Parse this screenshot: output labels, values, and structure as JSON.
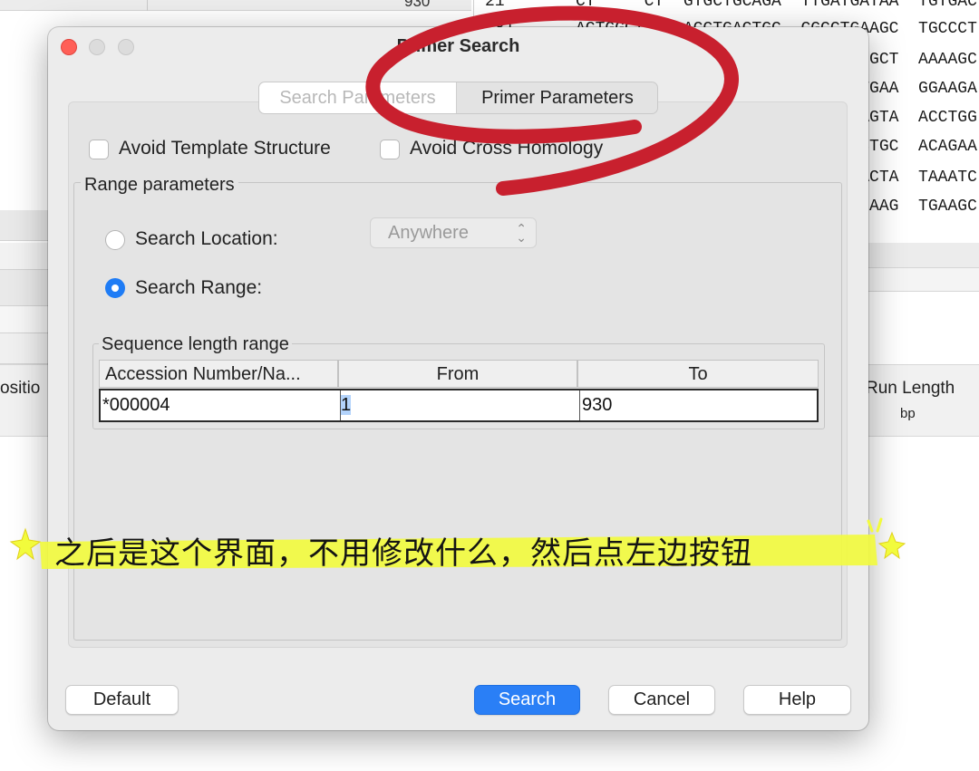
{
  "background": {
    "top_number": "930",
    "sequence_rows": [
      {
        "num": "21",
        "text": "CT     CT  GTGCTGCAGA  TTGATGATAA  TGTGAC"
      },
      {
        "num": "481",
        "text": "ACTGGCTTC  ACCTGACTGC  CGCCTGAAGC  TGCCCT"
      },
      {
        "num": "",
        "text": "                             GGCT  AAAAGC"
      },
      {
        "num": "",
        "text": "                             TGAA  GGAAGA"
      },
      {
        "num": "",
        "text": "                             AGTA  ACCTGG"
      },
      {
        "num": "",
        "text": "                             CTGC  ACAGAA"
      },
      {
        "num": "",
        "text": "                             ACTA  TAAATC"
      },
      {
        "num": "",
        "text": "                             GAAG  TGAAGC"
      }
    ],
    "left_column_header": "ositio",
    "right_column_header": "Run Length",
    "right_column_unit": "bp"
  },
  "dialog": {
    "title": "Primer Search",
    "tabs": [
      {
        "label": "Search Parameters",
        "selected": true
      },
      {
        "label": "Primer Parameters",
        "selected": false
      }
    ],
    "checkboxes": [
      {
        "label": "Avoid Template Structure",
        "checked": false
      },
      {
        "label": "Avoid Cross Homology",
        "checked": false
      }
    ],
    "range_group_title": "Range parameters",
    "search_location_label": "Search Location:",
    "search_location_value": "Anywhere",
    "search_range_label": "Search Range:",
    "search_range_selected": true,
    "seq_group_title": "Sequence length range",
    "table": {
      "headers": [
        "Accession Number/Na...",
        "From",
        "To"
      ],
      "rows": [
        {
          "accession": "*000004",
          "from": "1",
          "to": "930"
        }
      ]
    },
    "buttons": {
      "default": "Default",
      "search": "Search",
      "cancel": "Cancel",
      "help": "Help"
    }
  },
  "annotation": {
    "text": "之后是这个界面，不用修改什么，然后点左边按钮",
    "highlight_color": "#f2fb3c",
    "circle_color": "#c8202e"
  }
}
